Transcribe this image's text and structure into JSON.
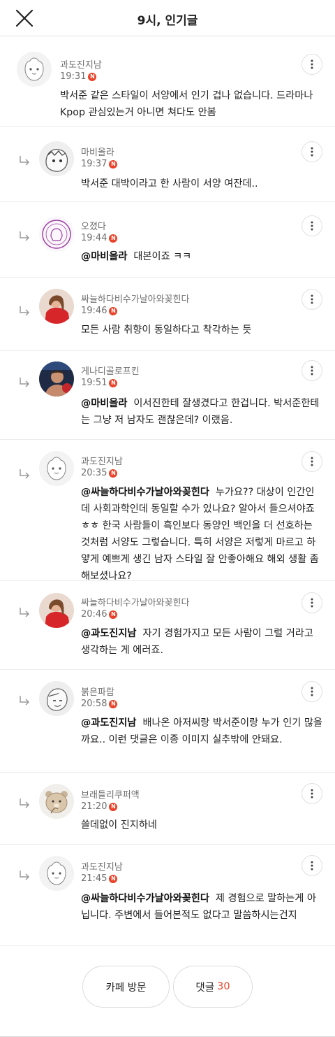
{
  "header": {
    "title": "9시, 인기글"
  },
  "comments": [
    {
      "nickname": "과도진지남",
      "time": "19:31",
      "badge": "N",
      "mention": "",
      "text": "박서준 같은 스타일이 서양에서 인기 겁나 없습니다. 드라마나 Kpop 관심있는거 아니면 쳐다도 안봄",
      "avatar": "default-face"
    },
    {
      "nickname": "마비올라",
      "time": "19:37",
      "badge": "N",
      "mention": "",
      "text": "박서준 대박이라고 한 사람이 서양 여잔데..",
      "avatar": "sketch-face"
    },
    {
      "nickname": "오졌다",
      "time": "19:44",
      "badge": "N",
      "mention": "@마비올라",
      "text": "대본이죠 ㅋㅋ",
      "avatar": "purple-stamp"
    },
    {
      "nickname": "싸늘하다비수가날아와꽂힌다",
      "time": "19:46",
      "badge": "N",
      "mention": "",
      "text": "모든 사람 취향이 동일하다고 착각하는 듯",
      "avatar": "red-jersey-photo"
    },
    {
      "nickname": "게나디골로프킨",
      "time": "19:51",
      "badge": "N",
      "mention": "@마비올라",
      "text": "이서진한테 잘생겼다고 한겁니다. 박서준한테는 그냥 저 남자도 괜찮은데? 이랬음.",
      "avatar": "boxer-photo"
    },
    {
      "nickname": "과도진지남",
      "time": "20:35",
      "badge": "N",
      "mention": "@싸늘하다비수가날아와꽂힌다",
      "text": "누가요?? 대상이 인간인데 사회과학인데 동일할 수가 있나요? 알아서 들으셔야죠 ㅎㅎ 한국 사람들이 흑인보다 동양인 백인을 더 선호하는 것처럼 서양도 그렇습니다. 특히 서양은 저렇게 마르고 하얗게 예쁘게 생긴 남자 스타일 잘 안좋아해요 해외 생활 좀 해보셨나요?",
      "avatar": "default-face"
    },
    {
      "nickname": "싸늘하다비수가날아와꽂힌다",
      "time": "20:46",
      "badge": "N",
      "mention": "@과도진지남",
      "text": "자기 경험가지고 모든 사람이 그럴 거라고 생각하는 게 에러죠.",
      "avatar": "red-jersey-photo"
    },
    {
      "nickname": "붉은파람",
      "time": "20:58",
      "badge": "N",
      "mention": "@과도진지남",
      "text": "배나온 아저씨랑 박서준이랑 누가 인기 많을까요.. 이런 댓글은 이종 이미지 실추밖에 안돼요.",
      "avatar": "sketch-face-2"
    },
    {
      "nickname": "브래들리쿠퍼액",
      "time": "21:20",
      "badge": "N",
      "mention": "",
      "text": "쓸데없이 진지하네",
      "avatar": "bear-face"
    },
    {
      "nickname": "과도진지남",
      "time": "21:45",
      "badge": "N",
      "mention": "@싸늘하다비수가날아와꽂힌다",
      "text": "제 경험으로 말하는게 아닙니다. 주변에서 들어본적도 없다고 말씀하시는건지",
      "avatar": "default-face"
    }
  ],
  "footer": {
    "visit_label": "카페 방문",
    "comments_label": "댓글",
    "comments_count": "30"
  },
  "colors": {
    "accent": "#e8432a",
    "muted": "#6e6e6e"
  }
}
